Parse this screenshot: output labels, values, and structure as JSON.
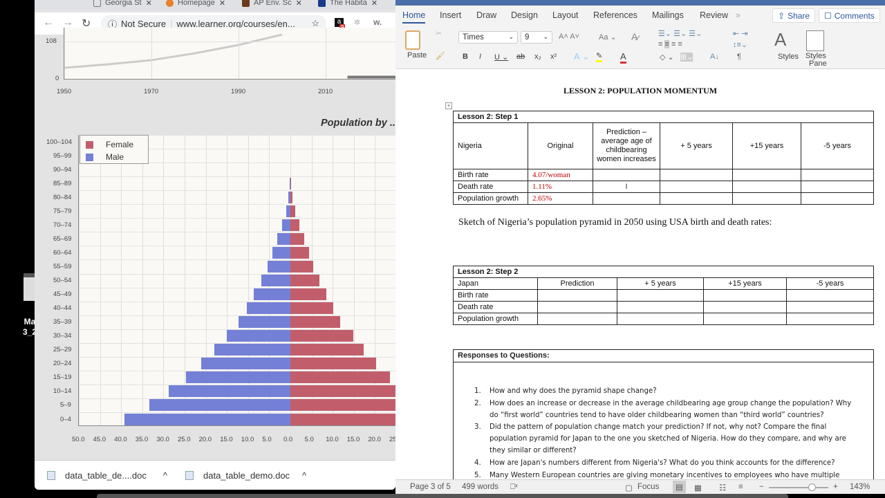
{
  "desktop": {
    "icon_label_1": "Ma",
    "icon_label_2": "3_2"
  },
  "browser": {
    "tabs": [
      {
        "label": "Georgia St",
        "color": "#ffffff"
      },
      {
        "label": "Homepage",
        "color": "#e8822a"
      },
      {
        "label": "AP Env. Sc",
        "color": "#6b3a1a"
      },
      {
        "label": "The Habita",
        "color": "#1a3a8a"
      }
    ],
    "not_secure": "Not Secure",
    "url": "www.learner.org/courses/en...",
    "ext_badge": "9",
    "ext_w": "w.",
    "downloads": [
      {
        "name": "data_table_de....doc"
      },
      {
        "name": "data_table_demo.doc"
      }
    ]
  },
  "chart_data": [
    {
      "type": "line",
      "title": "",
      "x_ticks": [
        "1950",
        "1970",
        "1990",
        "2010"
      ],
      "y_ticks": [
        "0",
        "108"
      ],
      "series": [
        {
          "name": "population",
          "color": "#cccccc",
          "x": [
            1950,
            1960,
            1970,
            1980,
            1990,
            2000
          ],
          "y": [
            32,
            42,
            54,
            74,
            98,
            128
          ]
        },
        {
          "name": "current",
          "color": "#777777",
          "x": [
            2015,
            2030
          ],
          "y": [
            5,
            5
          ]
        }
      ]
    },
    {
      "type": "bar",
      "orientation": "horizontal-pyramid",
      "title": "Population by ...",
      "categories": [
        "100–104",
        "95–99",
        "90–94",
        "85–89",
        "80–84",
        "75–79",
        "70–74",
        "65–69",
        "60–64",
        "55–59",
        "50–54",
        "45–49",
        "40–44",
        "35–39",
        "30–34",
        "25–29",
        "20–24",
        "15–19",
        "10–14",
        "5–9",
        "0–4"
      ],
      "series": [
        {
          "name": "Female",
          "color": "#c25e6b",
          "values": [
            0,
            0,
            0,
            0.1,
            0.5,
            1.1,
            2.2,
            3.3,
            4.4,
            5.4,
            6.9,
            8.5,
            10.1,
            11.8,
            14.9,
            17.3,
            20.3,
            23.5,
            28.0,
            32.5,
            38.0
          ]
        },
        {
          "name": "Male",
          "color": "#7480d6",
          "values": [
            0,
            0,
            0,
            0.1,
            0.5,
            1.0,
            2.0,
            3.1,
            4.2,
            5.4,
            6.9,
            8.7,
            10.3,
            12.3,
            15.0,
            18.0,
            21.1,
            24.7,
            28.8,
            33.3,
            39.2
          ]
        }
      ],
      "x_ticks_left": [
        "50.0",
        "45.0",
        "40.0",
        "35.0",
        "30.0",
        "25.0",
        "20.0",
        "15.0",
        "10.0",
        "5.0"
      ],
      "x_ticks_right": [
        "0.0",
        "5.0",
        "10.0",
        "15.0",
        "20.0",
        "25"
      ],
      "xlim": [
        -50,
        25
      ],
      "legend": [
        "Female",
        "Male"
      ],
      "legend_position": "top-left"
    }
  ],
  "word": {
    "tabs": [
      "Home",
      "Insert",
      "Draw",
      "Design",
      "Layout",
      "References",
      "Mailings",
      "Review",
      "»"
    ],
    "share": "Share",
    "comments": "Comments",
    "font": "Times",
    "size": "9",
    "paste": "Paste",
    "styles": "Styles",
    "styles_pane_1": "Styles",
    "styles_pane_2": "Pane",
    "doc_title": "LESSON 2: POPULATION MOMENTUM",
    "table1": {
      "caption": "Lesson 2:  Step 1",
      "headers": [
        "Nigeria",
        "Original",
        "Prediction – average age of childbearing women increases",
        "+ 5 years",
        "+15 years",
        "-5 years"
      ],
      "rows": [
        {
          "label": "Birth rate",
          "original": "4.07/woman"
        },
        {
          "label": "Death rate",
          "original": "1.11%"
        },
        {
          "label": "Population growth",
          "original": "2.65%"
        }
      ]
    },
    "sketch_text": "Sketch of Nigeria’s population pyramid in 2050 using USA birth and death rates:",
    "table2": {
      "caption": "Lesson 2:  Step 2",
      "headers": [
        "Japan",
        "Prediction",
        "+ 5 years",
        "+15 years",
        "-5 years"
      ],
      "rows": [
        "Birth rate",
        "Death rate",
        "Population growth"
      ]
    },
    "responses_header": "Responses to Questions:",
    "questions": [
      {
        "n": "1.",
        "text": "How and why does the pyramid shape change?"
      },
      {
        "n": "2.",
        "text": "How does an increase or decrease in the average childbearing age group change the population? Why do “first world” countries tend to have older childbearing women than “third world” countries?"
      },
      {
        "n": "3.",
        "text": "Did the pattern of population change match your prediction? If not, why not? Compare the final population pyramid for Japan to the one you sketched of Nigeria. How do they compare, and why are they similar or different?"
      },
      {
        "n": "4.",
        "text": "How are Japan's numbers different from Nigeria's? What do you think accounts for the difference?"
      },
      {
        "n": "5.",
        "text": "Many Western European countries are giving monetary incentives to employees who have multiple"
      }
    ],
    "status": {
      "page": "Page 3 of 5",
      "words": "499 words",
      "focus": "Focus",
      "zoom": "143%",
      "zoom_fraction": 0.72
    }
  }
}
